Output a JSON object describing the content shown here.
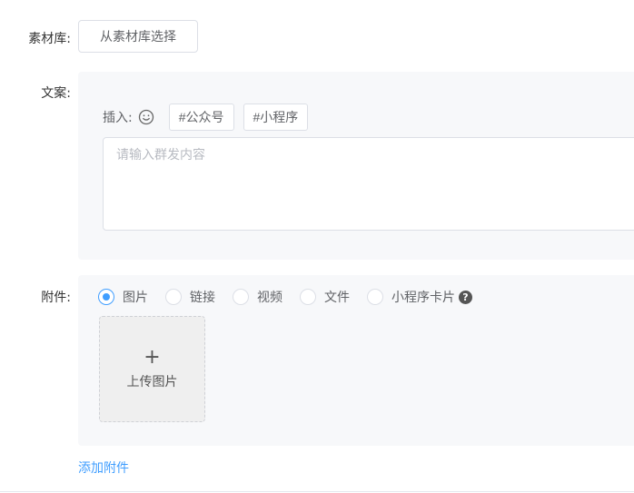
{
  "material": {
    "label": "素材库:",
    "button_label": "从素材库选择"
  },
  "copy": {
    "label": "文案:",
    "insert_label": "插入:",
    "tags": [
      "#公众号",
      "#小程序"
    ],
    "textarea_placeholder": "请输入群发内容",
    "textarea_value": ""
  },
  "attachment": {
    "label": "附件:",
    "options": [
      {
        "label": "图片",
        "checked": true
      },
      {
        "label": "链接",
        "checked": false
      },
      {
        "label": "视频",
        "checked": false
      },
      {
        "label": "文件",
        "checked": false
      },
      {
        "label": "小程序卡片",
        "checked": false
      }
    ],
    "help_icon": "question-circle-icon",
    "upload_icon": "plus-icon",
    "upload_label": "上传图片",
    "add_link": "添加附件"
  },
  "colors": {
    "accent": "#409eff",
    "panel_bg": "#f7f8fa"
  }
}
